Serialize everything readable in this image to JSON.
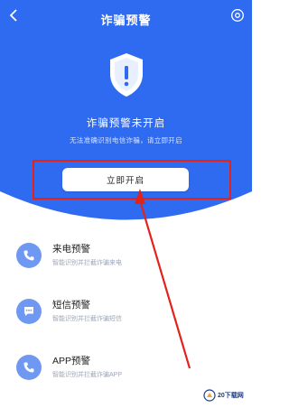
{
  "header": {
    "title": "诈骗预警",
    "back_icon": "chevron-left-icon",
    "settings_icon": "gear-icon"
  },
  "hero": {
    "status": "诈骗预警未开启",
    "subtitle": "无法准确识别电信诈骗，请立即开启",
    "button_label": "立即开启",
    "bg_color": "#2f6bf0",
    "shield_icon": "shield-warning-icon"
  },
  "features": [
    {
      "label": "来电预警",
      "desc": "智能识别并拦截诈骗来电",
      "icon": "phone-icon"
    },
    {
      "label": "短信预警",
      "desc": "智能识别并拦截诈骗短信",
      "icon": "message-icon"
    },
    {
      "label": "APP预警",
      "desc": "智能识别并拦截诈骗APP",
      "icon": "app-icon"
    }
  ],
  "annotation": {
    "highlight_color": "#e2231a"
  },
  "watermark": {
    "text": "20下载网"
  }
}
